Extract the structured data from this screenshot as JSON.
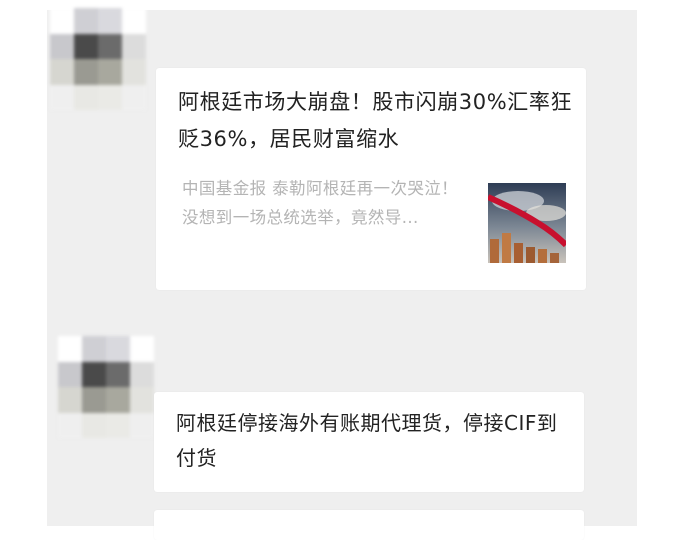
{
  "messages": [
    {
      "type": "link-card",
      "title": "阿根廷市场大崩盘！股市闪崩30%汇率狂贬36%，居民财富缩水",
      "summary": "中国基金报 泰勒阿根廷再一次哭泣！没想到一场总统选举，竟然导...",
      "thumbnail": "stock-chart-thumbnail"
    },
    {
      "type": "text",
      "text": "阿根廷停接海外有账期代理货，停接CIF到付货"
    }
  ],
  "colors": {
    "chat_background": "#efefef",
    "bubble": "#ffffff",
    "primary_text": "#222222",
    "secondary_text": "#b4b4b4"
  }
}
